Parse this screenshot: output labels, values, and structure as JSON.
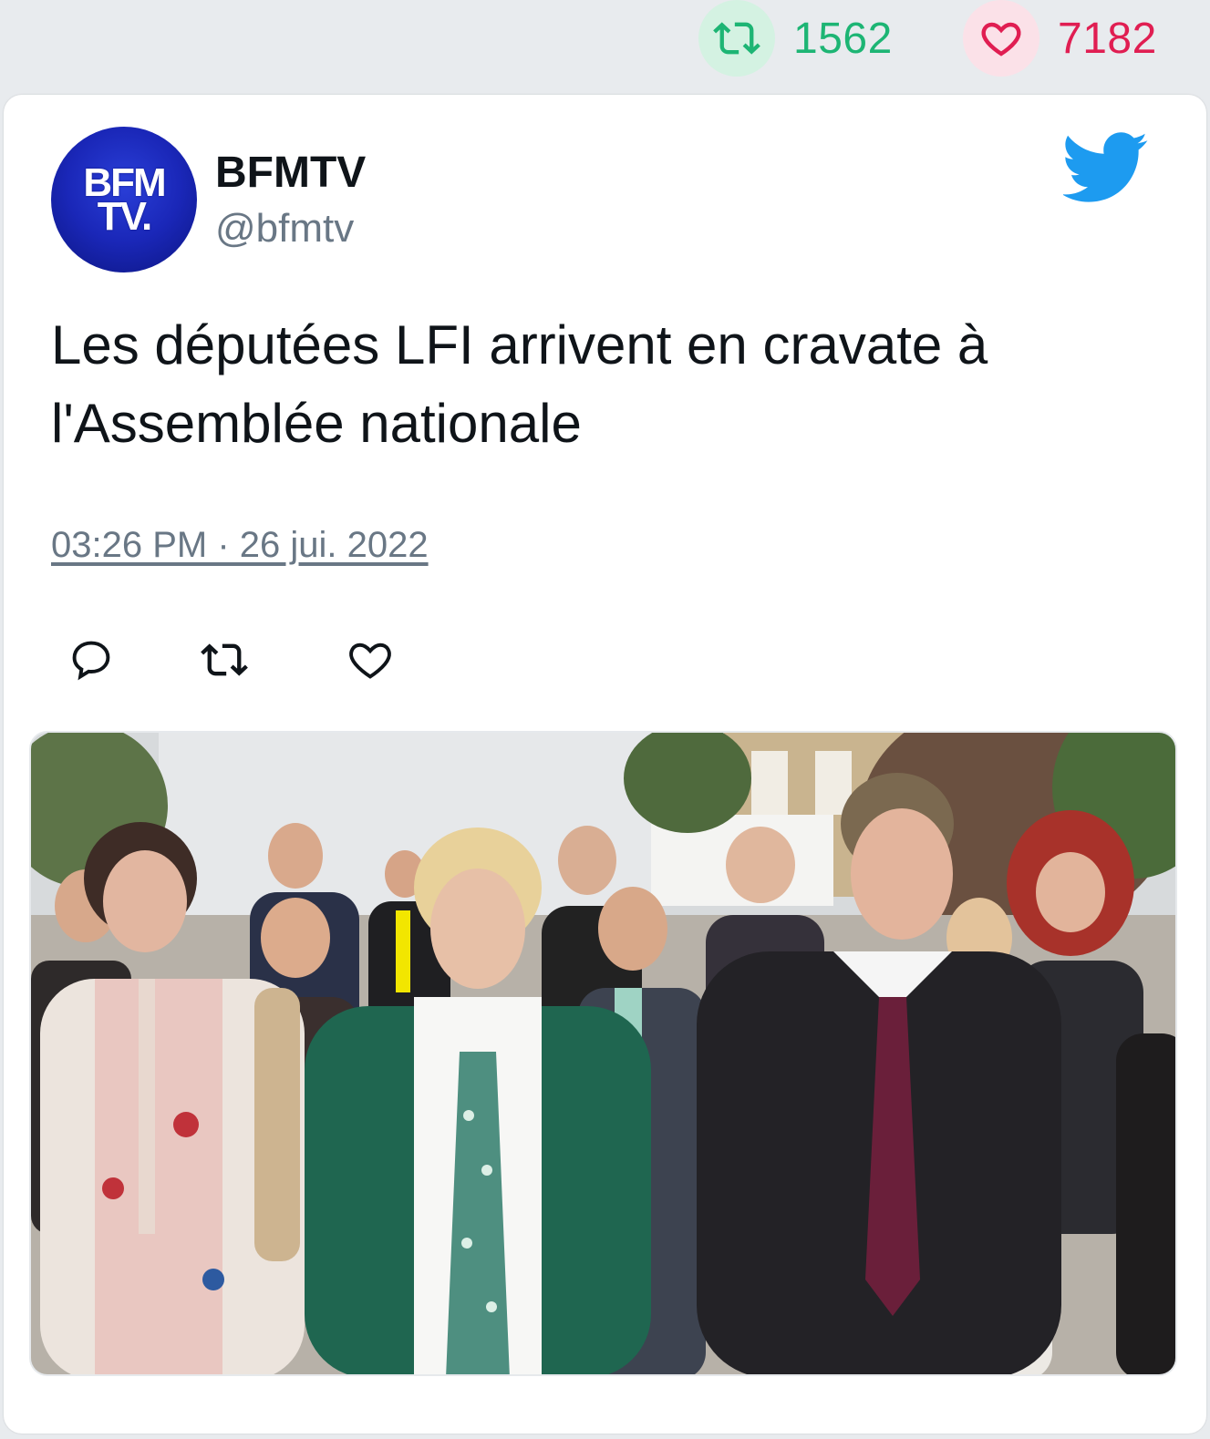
{
  "stats": {
    "retweet_count": "1562",
    "like_count": "7182",
    "retweet_icon": "retweet-icon",
    "like_icon": "heart-icon",
    "retweet_color": "#1db574",
    "like_color": "#e01e52"
  },
  "tweet": {
    "avatar": {
      "line1": "BFM",
      "line2": "TV.",
      "color": "#1a27b8"
    },
    "display_name": "BFMTV",
    "handle": "@bfmtv",
    "text": "Les députées LFI arrivent en cravate à l'Assemblée nationale",
    "timestamp": "03:26 PM · 26 jui. 2022",
    "brand_icon": "twitter-bird-icon",
    "brand_color": "#1d9bf0",
    "actions": [
      {
        "name": "reply",
        "icon": "reply-icon"
      },
      {
        "name": "retweet",
        "icon": "retweet-icon"
      },
      {
        "name": "like",
        "icon": "heart-icon"
      }
    ]
  }
}
